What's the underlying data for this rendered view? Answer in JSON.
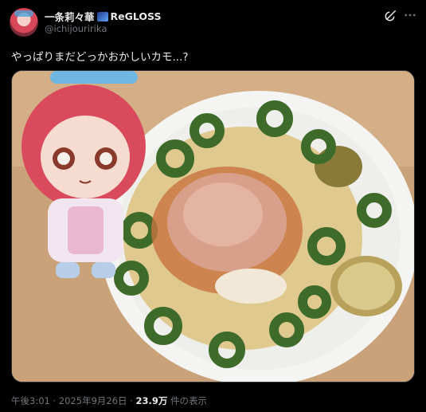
{
  "post": {
    "display_name": "一条莉々華",
    "group": "ReGLOSS",
    "handle": "@ichijouririka",
    "text": "やっぱりまだどっかおかしいカモ...?",
    "media_icon": "photo"
  },
  "actions": {
    "grok_icon": "grok-icon",
    "more_icon": "more-icon"
  },
  "meta": {
    "time": "午後3:01",
    "sep1": " · ",
    "date": "2025年9月26日",
    "sep2": " · ",
    "views": "23.9万",
    "views_suffix": " 件の表示"
  },
  "colors": {
    "background": "#000000",
    "text": "#e7e9ea",
    "secondary": "#71767b"
  }
}
